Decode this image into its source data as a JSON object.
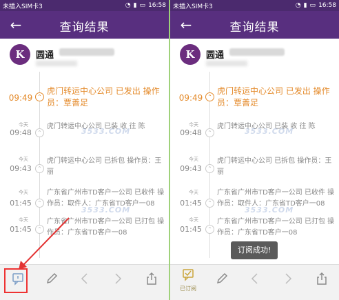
{
  "status_bar": {
    "carrier": "未插入SIM卡3",
    "time": "16:58"
  },
  "header": {
    "back_icon": "arrow-left-icon",
    "title": "查询结果"
  },
  "company": {
    "logo_text": "K",
    "name": "圆通",
    "tracking_number": "88888888888"
  },
  "events": [
    {
      "day": "",
      "time": "09:49",
      "text": "虎门转运中心公司 已发出 操作员：覃善足"
    },
    {
      "day": "今天",
      "time": "09:48",
      "text": "虎门转运中心公司 已装 收 往 陈"
    },
    {
      "day": "今天",
      "time": "09:43",
      "text": "虎门转运中心公司 已拆包 操作员：王丽"
    },
    {
      "day": "今天",
      "time": "01:45",
      "text": "广东省广州市TD客户一公司 已收件 操作员：取件人：广东省TD客户一08"
    },
    {
      "day": "今天",
      "time": "01:45",
      "text": "广东省广州市TD客户一公司 已打包 操作员：广东省TD客户一08"
    }
  ],
  "watermark": "3533.COM",
  "toolbar": {
    "subscribe_icon": "subscribe-chat-icon",
    "edit_icon": "pencil-icon",
    "prev_icon": "chevron-left-icon",
    "next_icon": "chevron-right-icon",
    "share_icon": "share-icon",
    "subscribed_label": "已订阅"
  },
  "toast": "订阅成功!",
  "colors": {
    "header": "#582f7f",
    "accent": "#e48a2a",
    "annotation": "#e33333",
    "subscribed": "#c9a53a"
  }
}
